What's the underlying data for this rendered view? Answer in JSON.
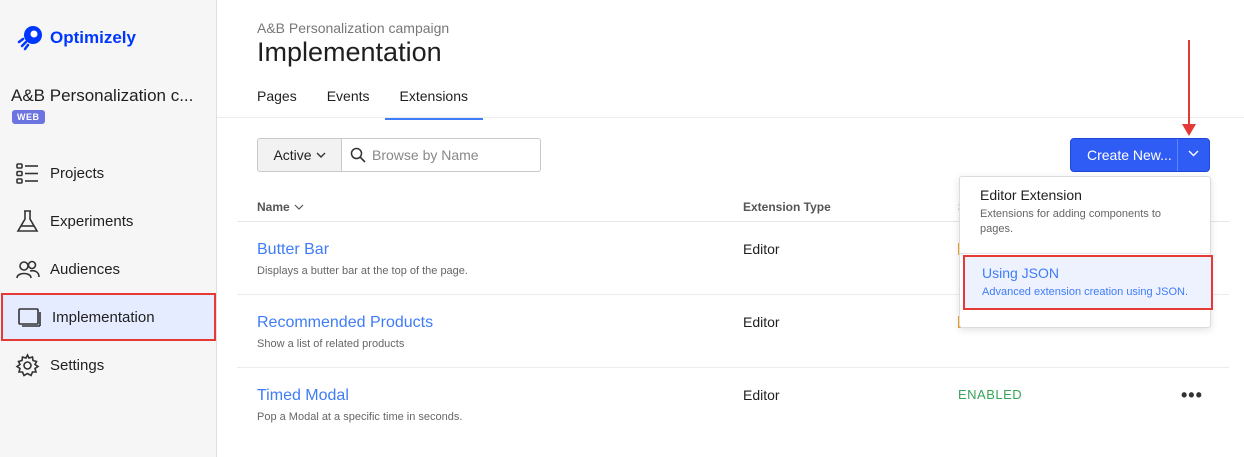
{
  "sidebar": {
    "logo_text": "Optimizely",
    "project_name": "A&B Personalization c...",
    "platform_badge": "WEB",
    "items": [
      {
        "label": "Projects",
        "icon": "projects-icon"
      },
      {
        "label": "Experiments",
        "icon": "flask-icon"
      },
      {
        "label": "Audiences",
        "icon": "audiences-icon"
      },
      {
        "label": "Implementation",
        "icon": "implementation-icon",
        "active": true
      },
      {
        "label": "Settings",
        "icon": "gear-icon"
      }
    ]
  },
  "header": {
    "breadcrumb": "A&B Personalization campaign",
    "title": "Implementation",
    "tabs": [
      {
        "label": "Pages"
      },
      {
        "label": "Events"
      },
      {
        "label": "Extensions",
        "active": true
      }
    ]
  },
  "toolbar": {
    "status_filter": "Active",
    "search_placeholder": "Browse by Name",
    "create_label": "Create New..."
  },
  "table": {
    "columns": [
      "Name",
      "Extension Type",
      "S"
    ],
    "rows": [
      {
        "title": "Butter Bar",
        "description": "Displays a butter bar at the top of the page.",
        "type": "Editor",
        "status": ""
      },
      {
        "title": "Recommended Products",
        "description": "Show a list of related products",
        "type": "Editor",
        "status": ""
      },
      {
        "title": "Timed Modal",
        "description": "Pop a Modal at a specific time in seconds.",
        "type": "Editor",
        "status": "ENABLED"
      }
    ],
    "row_menu": "•••"
  },
  "dropdown": {
    "items": [
      {
        "title": "Editor Extension",
        "description": "Extensions for adding components to pages."
      },
      {
        "title": "Using JSON",
        "description": "Advanced extension creation using JSON.",
        "highlighted": true
      }
    ]
  },
  "colors": {
    "accent": "#3f7cf7",
    "primary_button": "#2f5cf5",
    "annotation_red": "#e53935",
    "enabled_green": "#3aa35a"
  }
}
